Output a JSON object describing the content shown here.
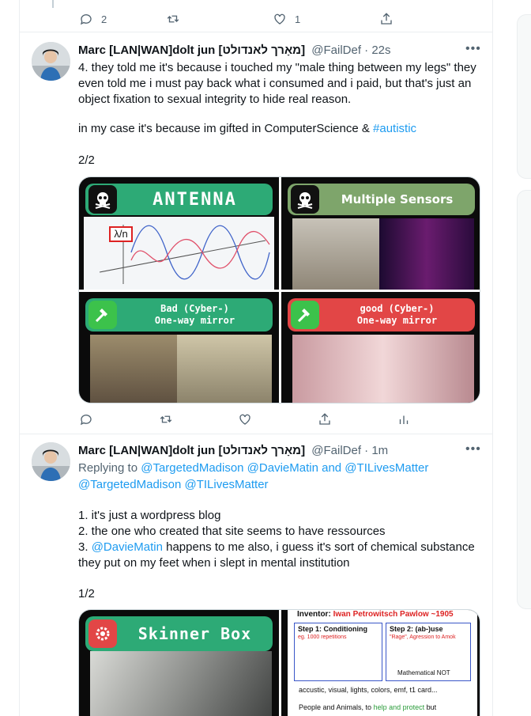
{
  "tweets": [
    {
      "actions": {
        "reply_count": "2",
        "retweet_count": "",
        "like_count": "1"
      }
    },
    {
      "author": {
        "name": "Marc [LAN|WAN]dolt jun [מאָרך לאנדולט]",
        "handle": "@FailDef",
        "time": "· 22s"
      },
      "more": "•••",
      "lines": {
        "p1": "4. they told me it's because i touched my \"male thing between my legs\" they even told me i must pay back what i consumed and i paid, but that's just an object fixation to sexual integrity to hide real reason.",
        "p2_prefix": "in my case it's because im gifted in ComputerScience & ",
        "p2_tag": "#autistic",
        "p3": "2/2"
      },
      "media": [
        {
          "title": "ANTENNA",
          "icon": "skull-icon",
          "color": "#2daa76",
          "label": "λ/n"
        },
        {
          "title": "Multiple Sensors",
          "icon": "skull-icon",
          "color": "#2daa76"
        },
        {
          "title_line1": "Bad (Cyber-)",
          "title_line2": "One-way mirror",
          "icon": "hammer-icon",
          "color": "#2daa76"
        },
        {
          "title_line1": "good (Cyber-)",
          "title_line2": "One-way mirror",
          "icon": "hammer-icon",
          "color": "#e24646"
        }
      ]
    },
    {
      "author": {
        "name": "Marc [LAN|WAN]dolt jun [מאָרך לאנדולט]",
        "handle": "@FailDef",
        "time": "· 1m"
      },
      "more": "•••",
      "replying": {
        "prefix": "Replying to ",
        "line1_mentions": "@TargetedMadison @DavieMatin and @TILivesMatter",
        "line2_mentions": "@TargetedMadison @TILivesMatter"
      },
      "lines": {
        "l1": "1. it's just a wordpress blog",
        "l2": "2. the one who created that site seems to have ressources",
        "l3_mention": "@DavieMatin",
        "l3_rest": " happens to me also, i guess it's sort of chemical substance",
        "l4": "they put on my feet when i slept in mental institution",
        "l5": "1/2"
      },
      "media": [
        {
          "title": "Skinner Box",
          "icon": "gear-icon",
          "color": "#2daa76"
        },
        {
          "inventor_label": "Inventor:",
          "inventor_name": "Iwan Petrowitsch Pawlow",
          "inventor_year": "~1905",
          "step1_title": "Step 1: Conditioning",
          "step1_sub": "eg. 1000 repetitions",
          "step2_title": "Step 2: (ab-)use",
          "step2_sub": "\"Rage\", Agression to Amok",
          "math_not": "Mathematical NOT",
          "list": "accustic, visual, lights, colors, emf, t1 card...",
          "people_prefix": "People and Animals, to ",
          "people_green": "help and protect",
          "people_suffix": " but"
        }
      ]
    }
  ]
}
